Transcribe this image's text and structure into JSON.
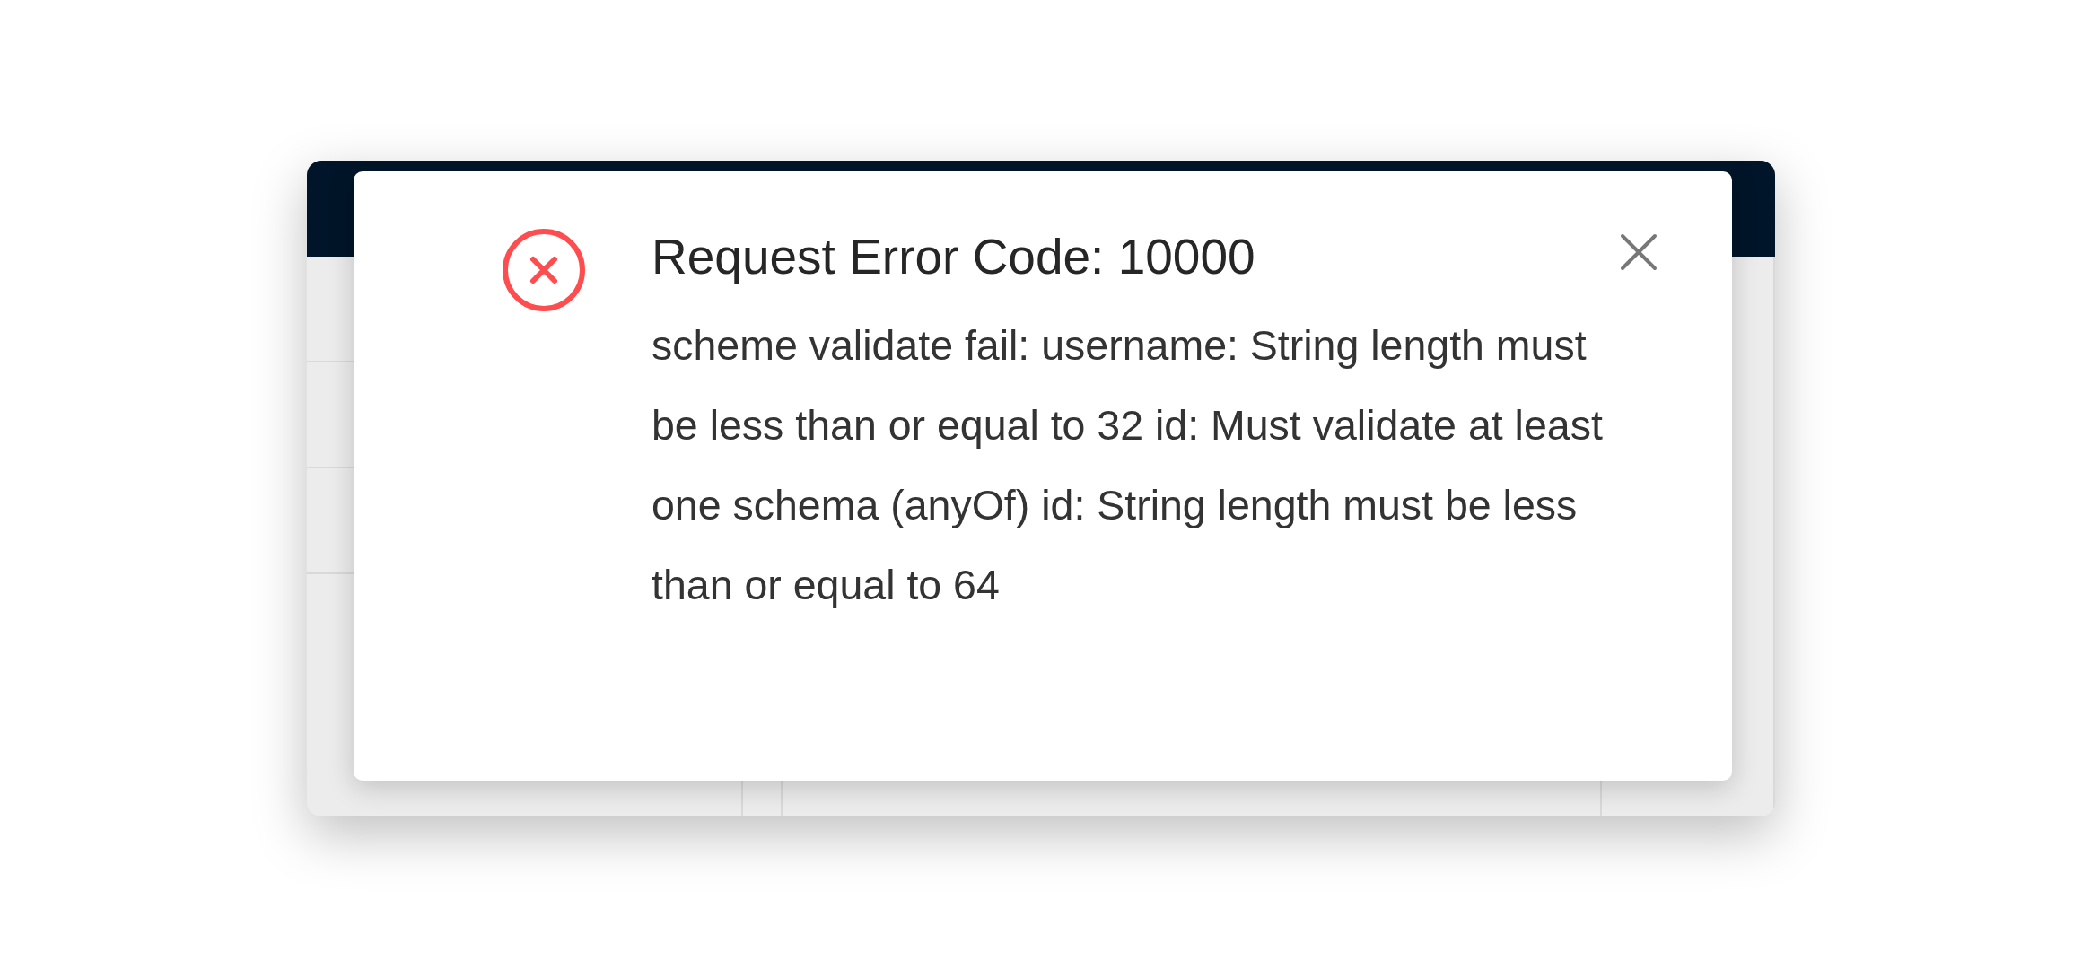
{
  "notification": {
    "kind": "error",
    "title": "Request Error Code: 10000",
    "message": "scheme validate fail: username: String length must be less than or equal to 32 id: Must validate at least one schema (anyOf) id: String length must be less than or equal to 64"
  }
}
